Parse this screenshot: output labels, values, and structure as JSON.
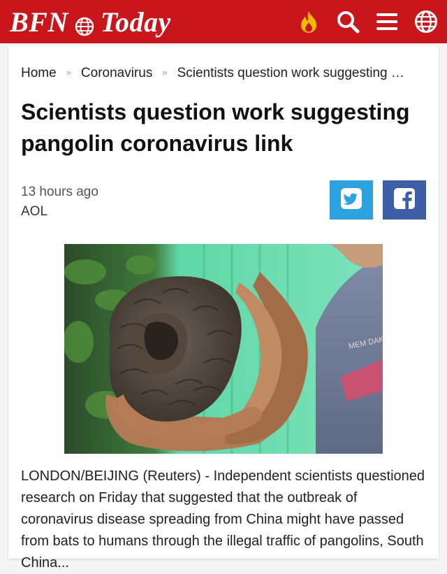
{
  "header": {
    "brand_left": "BFN",
    "brand_right": "Today",
    "icons": [
      "globe-logo-icon",
      "flame-icon",
      "search-icon",
      "menu-icon",
      "globe-icon"
    ],
    "background": "#c8161c"
  },
  "breadcrumb": {
    "items": [
      "Home",
      "Coronavirus",
      "Scientists question work suggesting …"
    ],
    "separator": "»"
  },
  "article": {
    "title": "Scientists question work suggesting pangolin coronavirus link",
    "time": "13 hours ago",
    "source": "AOL",
    "share": {
      "twitter_color": "#2ea1df",
      "facebook_color": "#3e5ea8"
    },
    "image_shirt_text": "MEM DAK BEDUITAN",
    "body": "LONDON/BEIJING (Reuters) - Independent scientists questioned research on Friday that suggested that the outbreak of coronavirus disease spreading from China might have passed from bats to humans through the illegal traffic of pangolins, South China..."
  }
}
